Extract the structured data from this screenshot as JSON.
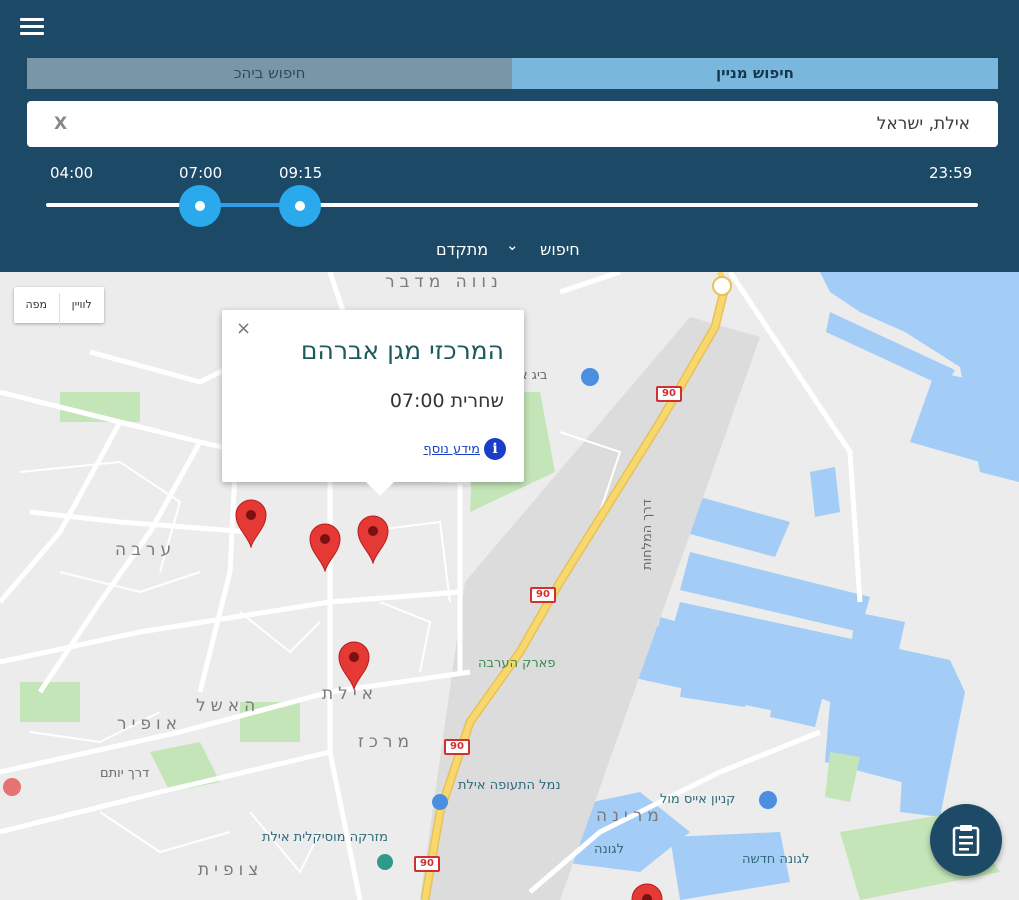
{
  "header": {
    "tabs": [
      {
        "label": "חיפוש ביהכ",
        "active": false
      },
      {
        "label": "חיפוש מניין",
        "active": true
      }
    ],
    "search": {
      "value": "אילת, ישראל",
      "clear_label": "X"
    },
    "time_slider": {
      "min_label": "04:00",
      "max_label": "23:59",
      "from_label": "07:00",
      "to_label": "09:15"
    },
    "advanced": {
      "search_label": "חיפוש",
      "advanced_label": "מתקדם"
    }
  },
  "map": {
    "map_type": {
      "satellite_label": "לוויין",
      "map_label": "מפה"
    },
    "popup": {
      "close_label": "×",
      "title": "המרכזי מגן אברהם",
      "prayer_name": "שחרית",
      "prayer_time": "07:00",
      "more_info_label": "מידע נוסף",
      "info_glyph": "i"
    },
    "labels": {
      "neve_midbar": "נווה מדבר",
      "big_eilat": "ביג אילת",
      "arava": "ערבה",
      "eilat": "אילת",
      "merkaz": "מרכז",
      "eshel": "האשל",
      "ofir": "אופיר",
      "park_arava": "פארק הערבה",
      "derech_yotam": "דרך יותם",
      "namal": "נמל התעופה אילת",
      "mizraka": "מזרקה מוסיקלית אילת",
      "tsofit": "צופית",
      "ice_mall": "קניון אייס מול",
      "marina": "מרינה",
      "laguna": "לגונה",
      "new_laguna": "לגונה חדשה",
      "derech_hamelachot": "דרך המלחות"
    },
    "road_number": "90",
    "colors": {
      "water": "#a3cdf6",
      "park": "#c4e5b8",
      "road_yellow": "#f6d66a",
      "pin": "#e53935"
    }
  },
  "fab": {
    "icon": "clipboard-icon"
  }
}
